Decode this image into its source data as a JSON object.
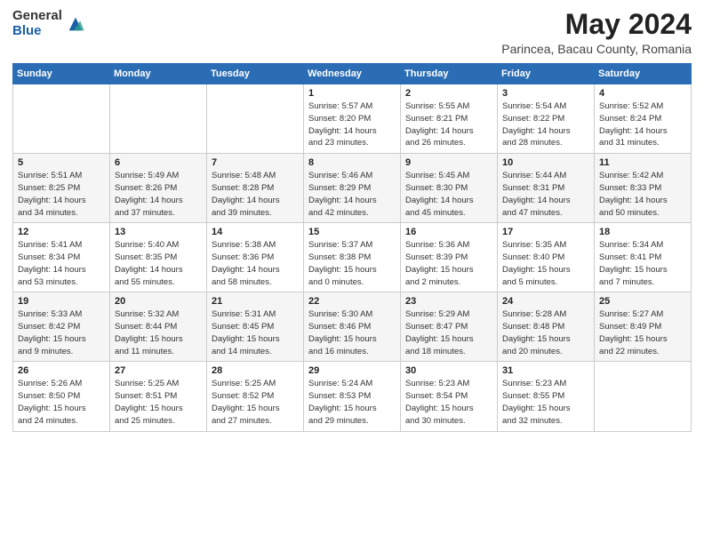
{
  "logo": {
    "general": "General",
    "blue": "Blue"
  },
  "title": "May 2024",
  "subtitle": "Parincea, Bacau County, Romania",
  "days_header": [
    "Sunday",
    "Monday",
    "Tuesday",
    "Wednesday",
    "Thursday",
    "Friday",
    "Saturday"
  ],
  "weeks": [
    [
      {
        "day": "",
        "info": ""
      },
      {
        "day": "",
        "info": ""
      },
      {
        "day": "",
        "info": ""
      },
      {
        "day": "1",
        "info": "Sunrise: 5:57 AM\nSunset: 8:20 PM\nDaylight: 14 hours\nand 23 minutes."
      },
      {
        "day": "2",
        "info": "Sunrise: 5:55 AM\nSunset: 8:21 PM\nDaylight: 14 hours\nand 26 minutes."
      },
      {
        "day": "3",
        "info": "Sunrise: 5:54 AM\nSunset: 8:22 PM\nDaylight: 14 hours\nand 28 minutes."
      },
      {
        "day": "4",
        "info": "Sunrise: 5:52 AM\nSunset: 8:24 PM\nDaylight: 14 hours\nand 31 minutes."
      }
    ],
    [
      {
        "day": "5",
        "info": "Sunrise: 5:51 AM\nSunset: 8:25 PM\nDaylight: 14 hours\nand 34 minutes."
      },
      {
        "day": "6",
        "info": "Sunrise: 5:49 AM\nSunset: 8:26 PM\nDaylight: 14 hours\nand 37 minutes."
      },
      {
        "day": "7",
        "info": "Sunrise: 5:48 AM\nSunset: 8:28 PM\nDaylight: 14 hours\nand 39 minutes."
      },
      {
        "day": "8",
        "info": "Sunrise: 5:46 AM\nSunset: 8:29 PM\nDaylight: 14 hours\nand 42 minutes."
      },
      {
        "day": "9",
        "info": "Sunrise: 5:45 AM\nSunset: 8:30 PM\nDaylight: 14 hours\nand 45 minutes."
      },
      {
        "day": "10",
        "info": "Sunrise: 5:44 AM\nSunset: 8:31 PM\nDaylight: 14 hours\nand 47 minutes."
      },
      {
        "day": "11",
        "info": "Sunrise: 5:42 AM\nSunset: 8:33 PM\nDaylight: 14 hours\nand 50 minutes."
      }
    ],
    [
      {
        "day": "12",
        "info": "Sunrise: 5:41 AM\nSunset: 8:34 PM\nDaylight: 14 hours\nand 53 minutes."
      },
      {
        "day": "13",
        "info": "Sunrise: 5:40 AM\nSunset: 8:35 PM\nDaylight: 14 hours\nand 55 minutes."
      },
      {
        "day": "14",
        "info": "Sunrise: 5:38 AM\nSunset: 8:36 PM\nDaylight: 14 hours\nand 58 minutes."
      },
      {
        "day": "15",
        "info": "Sunrise: 5:37 AM\nSunset: 8:38 PM\nDaylight: 15 hours\nand 0 minutes."
      },
      {
        "day": "16",
        "info": "Sunrise: 5:36 AM\nSunset: 8:39 PM\nDaylight: 15 hours\nand 2 minutes."
      },
      {
        "day": "17",
        "info": "Sunrise: 5:35 AM\nSunset: 8:40 PM\nDaylight: 15 hours\nand 5 minutes."
      },
      {
        "day": "18",
        "info": "Sunrise: 5:34 AM\nSunset: 8:41 PM\nDaylight: 15 hours\nand 7 minutes."
      }
    ],
    [
      {
        "day": "19",
        "info": "Sunrise: 5:33 AM\nSunset: 8:42 PM\nDaylight: 15 hours\nand 9 minutes."
      },
      {
        "day": "20",
        "info": "Sunrise: 5:32 AM\nSunset: 8:44 PM\nDaylight: 15 hours\nand 11 minutes."
      },
      {
        "day": "21",
        "info": "Sunrise: 5:31 AM\nSunset: 8:45 PM\nDaylight: 15 hours\nand 14 minutes."
      },
      {
        "day": "22",
        "info": "Sunrise: 5:30 AM\nSunset: 8:46 PM\nDaylight: 15 hours\nand 16 minutes."
      },
      {
        "day": "23",
        "info": "Sunrise: 5:29 AM\nSunset: 8:47 PM\nDaylight: 15 hours\nand 18 minutes."
      },
      {
        "day": "24",
        "info": "Sunrise: 5:28 AM\nSunset: 8:48 PM\nDaylight: 15 hours\nand 20 minutes."
      },
      {
        "day": "25",
        "info": "Sunrise: 5:27 AM\nSunset: 8:49 PM\nDaylight: 15 hours\nand 22 minutes."
      }
    ],
    [
      {
        "day": "26",
        "info": "Sunrise: 5:26 AM\nSunset: 8:50 PM\nDaylight: 15 hours\nand 24 minutes."
      },
      {
        "day": "27",
        "info": "Sunrise: 5:25 AM\nSunset: 8:51 PM\nDaylight: 15 hours\nand 25 minutes."
      },
      {
        "day": "28",
        "info": "Sunrise: 5:25 AM\nSunset: 8:52 PM\nDaylight: 15 hours\nand 27 minutes."
      },
      {
        "day": "29",
        "info": "Sunrise: 5:24 AM\nSunset: 8:53 PM\nDaylight: 15 hours\nand 29 minutes."
      },
      {
        "day": "30",
        "info": "Sunrise: 5:23 AM\nSunset: 8:54 PM\nDaylight: 15 hours\nand 30 minutes."
      },
      {
        "day": "31",
        "info": "Sunrise: 5:23 AM\nSunset: 8:55 PM\nDaylight: 15 hours\nand 32 minutes."
      },
      {
        "day": "",
        "info": ""
      }
    ]
  ]
}
